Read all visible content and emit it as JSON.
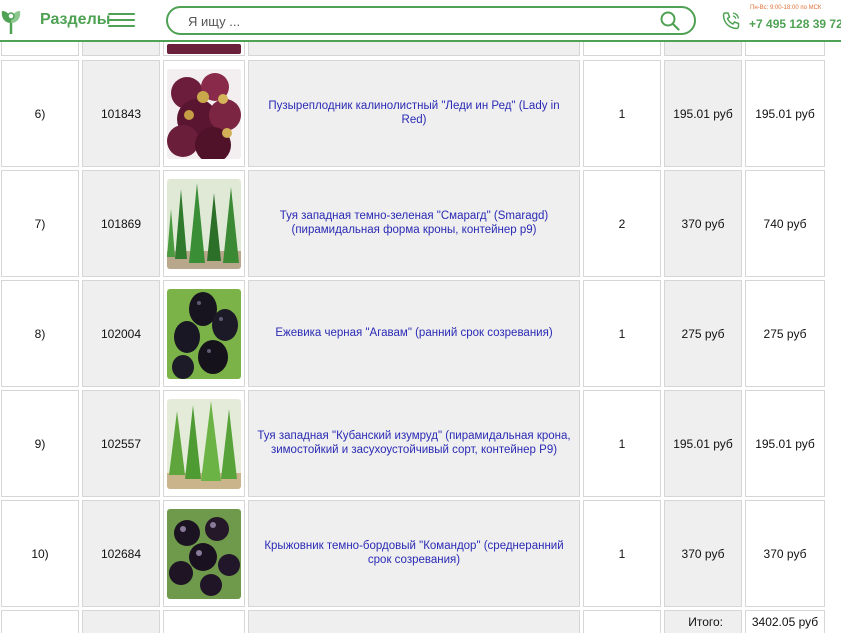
{
  "header": {
    "sections_label": "Разделы",
    "search_placeholder": "Я ищу ...",
    "work_hours": "Пн-Вс: 9:00-18:00 по МСК",
    "phone": "+7 495 128 39 72"
  },
  "rows": [
    {
      "num": "6)",
      "code": "101843",
      "name": "Пузыреплодник калинолистный \"Леди ин Ред\" (Lady in Red)",
      "qty": "1",
      "price": "195.01 руб",
      "sum": "195.01 руб",
      "image": "physocarpus-red-leaves"
    },
    {
      "num": "7)",
      "code": "101869",
      "name": "Туя западная темно-зеленая \"Смарагд\" (Smaragd) (пирамидальная форма кроны, контейнер р9)",
      "qty": "2",
      "price": "370 руб",
      "sum": "740 руб",
      "image": "thuja-smaragd"
    },
    {
      "num": "8)",
      "code": "102004",
      "name": "Ежевика черная \"Агавам\" (ранний срок созревания)",
      "qty": "1",
      "price": "275 руб",
      "sum": "275 руб",
      "image": "blackberry"
    },
    {
      "num": "9)",
      "code": "102557",
      "name": "Туя западная \"Кубанский изумруд\" (пирамидальная крона, зимостойкий и засухоустойчивый сорт, контейнер Р9)",
      "qty": "1",
      "price": "195.01 руб",
      "sum": "195.01 руб",
      "image": "thuja-kuban-emerald"
    },
    {
      "num": "10)",
      "code": "102684",
      "name": "Крыжовник темно-бордовый \"Командор\" (среднеранний срок созревания)",
      "qty": "1",
      "price": "370 руб",
      "sum": "370 руб",
      "image": "gooseberry-dark"
    }
  ],
  "total": {
    "label": "Итого:",
    "value": "3402.05 руб"
  },
  "colors": {
    "accent": "#4fa254",
    "link": "#2a2ab5",
    "cell_gray": "#efefef",
    "hours": "#e0723a"
  }
}
